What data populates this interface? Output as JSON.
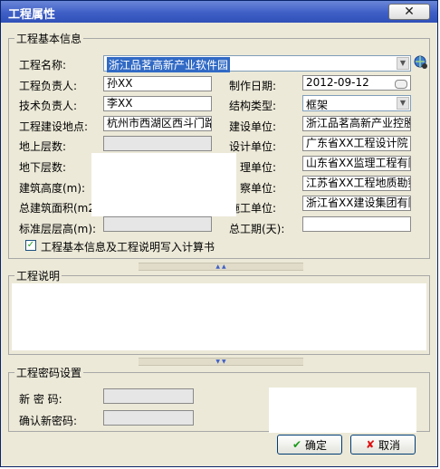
{
  "window": {
    "title": "工程属性",
    "close_glyph": "✕"
  },
  "basic": {
    "legend": "工程基本信息",
    "name_label": "工程名称:",
    "name_value": "浙江品茗高新产业软件园",
    "owner_label": "工程负责人:",
    "owner_value": "孙XX",
    "tech_label": "技术负责人:",
    "tech_value": "李XX",
    "site_label": "工程建设地点:",
    "site_value": "杭州市西湖区西斗门路",
    "above_label": "地上层数:",
    "below_label": "地下层数:",
    "height_label": "建筑高度(m):",
    "area_label": "总建筑面积(m2):",
    "std_height_label": "标准层层高(m):",
    "date_label": "制作日期:",
    "date_value": "2012-09-12",
    "structure_label": "结构类型:",
    "structure_value": "框架",
    "build_unit_label": "建设单位:",
    "build_unit_value": "浙江品茗高新产业控股",
    "design_unit_label": "设计单位:",
    "design_unit_value": "广东省XX工程设计院",
    "supervise_label": "理单位:",
    "supervise_value": "山东省XX监理工程有限",
    "survey_label": "察单位:",
    "survey_value": "江苏省XX工程地质勘察",
    "construct_label": "施工单位:",
    "construct_value": "浙江省XX建设集团有限",
    "period_label": "总工期(天):",
    "write_checkbox_label": "工程基本信息及工程说明写入计算书",
    "write_checked": true
  },
  "description": {
    "legend": "工程说明"
  },
  "password": {
    "legend": "工程密码设置",
    "new_label": "新 密 码:",
    "confirm_label": "确认新密码:"
  },
  "buttons": {
    "ok": "确定",
    "cancel": "取消"
  },
  "colors": {
    "title_bar": "#3f5fc6",
    "selection": "#316ac5",
    "window_bg": "#ece9d8"
  }
}
